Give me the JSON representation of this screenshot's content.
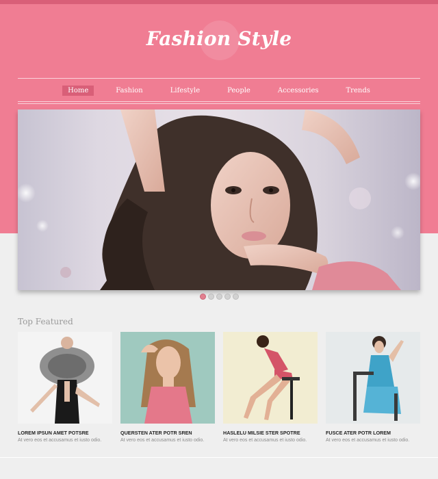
{
  "brand": {
    "logo_text": "Fashion Style"
  },
  "nav": {
    "items": [
      {
        "label": "Home",
        "active": true
      },
      {
        "label": "Fashion",
        "active": false
      },
      {
        "label": "Lifestyle",
        "active": false
      },
      {
        "label": "People",
        "active": false
      },
      {
        "label": "Accessories",
        "active": false
      },
      {
        "label": "Trends",
        "active": false
      }
    ]
  },
  "slider": {
    "slide_count": 5,
    "active_index": 0
  },
  "featured": {
    "title": "Top Featured",
    "items": [
      {
        "title": "LOREM IPSUN AMET POTSRE",
        "text": "At vero eos et accusamus et iusto odio."
      },
      {
        "title": "QUERSTEN ATER POTR SREN",
        "text": "At vero eos et accusamus et iusto odio."
      },
      {
        "title": "HASLELU MILSIE STER SPOTRE",
        "text": "At vero eos et accusamus et iusto odio."
      },
      {
        "title": "FUSCE ATER POTR LOREM",
        "text": "At vero eos et accusamus et iusto odio."
      }
    ]
  },
  "colors": {
    "brand_pink": "#f07d93",
    "accent_pink": "#d95f78",
    "page_bg": "#efefef"
  }
}
